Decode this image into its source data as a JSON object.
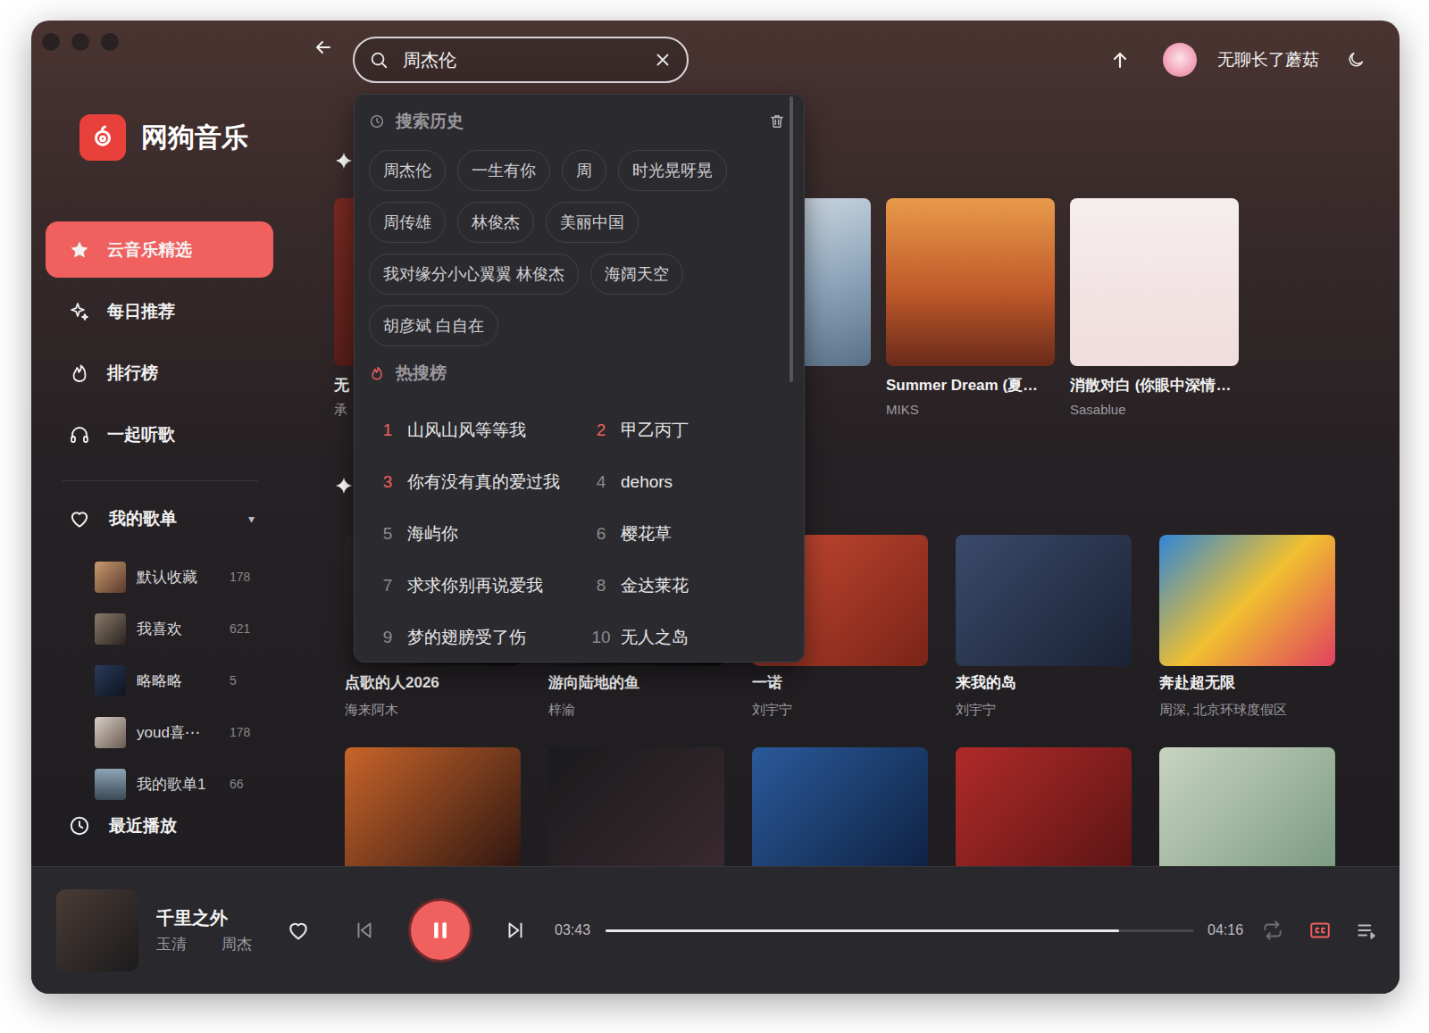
{
  "app": {
    "name": "网狗音乐"
  },
  "sidebar": {
    "items": [
      {
        "label": "云音乐精选",
        "selected": true
      },
      {
        "label": "每日推荐",
        "selected": false
      },
      {
        "label": "排行榜",
        "selected": false
      },
      {
        "label": "一起听歌",
        "selected": false
      }
    ],
    "playlists": {
      "label": "我的歌单",
      "toggle": "▾",
      "expanded": true,
      "items": [
        {
          "name": "默认收藏",
          "count": "178"
        },
        {
          "name": "我喜欢",
          "count": "621"
        },
        {
          "name": "略略略",
          "count": "5"
        },
        {
          "name": "youd喜⋯",
          "count": "178"
        },
        {
          "name": "我的歌单1",
          "count": "66"
        }
      ]
    },
    "recent": {
      "label": "最近播放"
    }
  },
  "topbar": {
    "search": {
      "value": "周杰伦"
    },
    "user": {
      "name": "无聊长了蘑菇"
    }
  },
  "search_dropdown": {
    "history": {
      "title": "搜索历史",
      "tags": [
        "周杰伦",
        "一生有你",
        "周",
        "时光晃呀晃",
        "周传雄",
        "林俊杰",
        "美丽中国",
        "我对缘分小心翼翼 林俊杰",
        "海阔天空",
        "胡彦斌 白自在"
      ]
    },
    "hot": {
      "title": "热搜榜",
      "items": [
        {
          "rank": "1",
          "title": "山风山风等等我",
          "top": true
        },
        {
          "rank": "2",
          "title": "甲乙丙丁",
          "top": true
        },
        {
          "rank": "3",
          "title": "你有没有真的爱过我",
          "top": true
        },
        {
          "rank": "4",
          "title": "dehors",
          "top": false
        },
        {
          "rank": "5",
          "title": "海屿你",
          "top": false
        },
        {
          "rank": "6",
          "title": "樱花草",
          "top": false
        },
        {
          "rank": "7",
          "title": "求求你别再说爱我",
          "top": false
        },
        {
          "rank": "8",
          "title": "金达莱花",
          "top": false
        },
        {
          "rank": "9",
          "title": "梦的翅膀受了伤",
          "top": false
        },
        {
          "rank": "10",
          "title": "无人之岛",
          "top": false
        }
      ]
    }
  },
  "sections": [
    {
      "cards": [
        {
          "title": "无",
          "artist": "承"
        },
        {},
        {},
        {
          "title": "Summer Dream (夏…",
          "artist": "MIKS"
        },
        {
          "title": "消散对白 (你眼中深情…",
          "artist": "Sasablue"
        }
      ]
    },
    {
      "cards": [
        {
          "title": "点歌的人2026",
          "artist": "海来阿木"
        },
        {
          "title": "游向陆地的鱼",
          "artist": "梓渝"
        },
        {
          "title": "一诺",
          "artist": "刘宇宁"
        },
        {
          "title": "来我的岛",
          "artist": "刘宇宁"
        },
        {
          "title": "奔赴超无限",
          "artist": "周深, 北京环球度假区"
        }
      ]
    },
    {
      "cards": [
        {},
        {},
        {},
        {},
        {}
      ]
    }
  ],
  "player": {
    "title": "千里之外",
    "artists": [
      "玉清",
      "周杰"
    ],
    "liked": false,
    "playing": true,
    "elapsed": "03:43",
    "duration": "04:16",
    "level": 0.873,
    "repeat_on": false,
    "lyrics_on": true
  }
}
